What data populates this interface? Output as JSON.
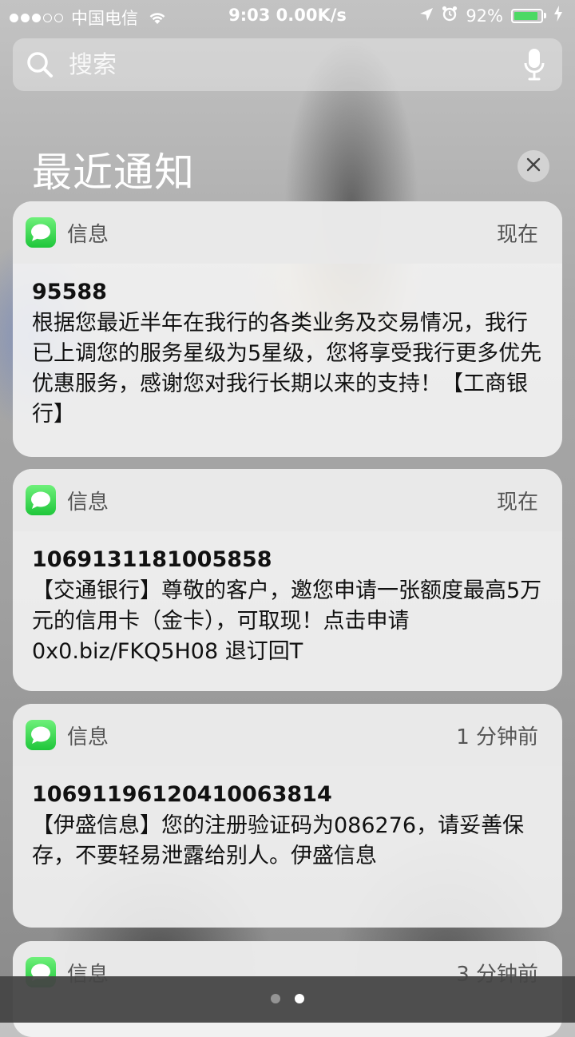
{
  "status_bar": {
    "carrier": "中国电信",
    "time_speed": "9:03 0.00K/s",
    "battery": "92%",
    "battery_level": 0.92,
    "battery_color": "#4cd964"
  },
  "search": {
    "placeholder": "搜索"
  },
  "section": {
    "title": "最近通知"
  },
  "notifications": [
    {
      "app": "信息",
      "time": "现在",
      "sender": "95588",
      "message": "根据您最近半年在我行的各类业务及交易情况，我行已上调您的服务星级为5星级，您将享受我行更多优先优惠服务，感谢您对我行长期以来的支持！【工商银行】"
    },
    {
      "app": "信息",
      "time": "现在",
      "sender": "1069131181005858",
      "message": "【交通银行】尊敬的客户，邀您申请一张额度最高5万元的信用卡（金卡），可取现！点击申请 0x0.biz/FKQ5H08 退订回T"
    },
    {
      "app": "信息",
      "time": "1 分钟前",
      "sender": "10691196120410063814",
      "message": "【伊盛信息】您的注册验证码为086276，请妥善保存，不要轻易泄露给别人。伊盛信息"
    },
    {
      "app": "信息",
      "time": "3 分钟前"
    }
  ],
  "icons": {
    "app": "messages-icon",
    "search": "search-icon",
    "mic": "microphone-icon",
    "clear": "close-icon"
  }
}
